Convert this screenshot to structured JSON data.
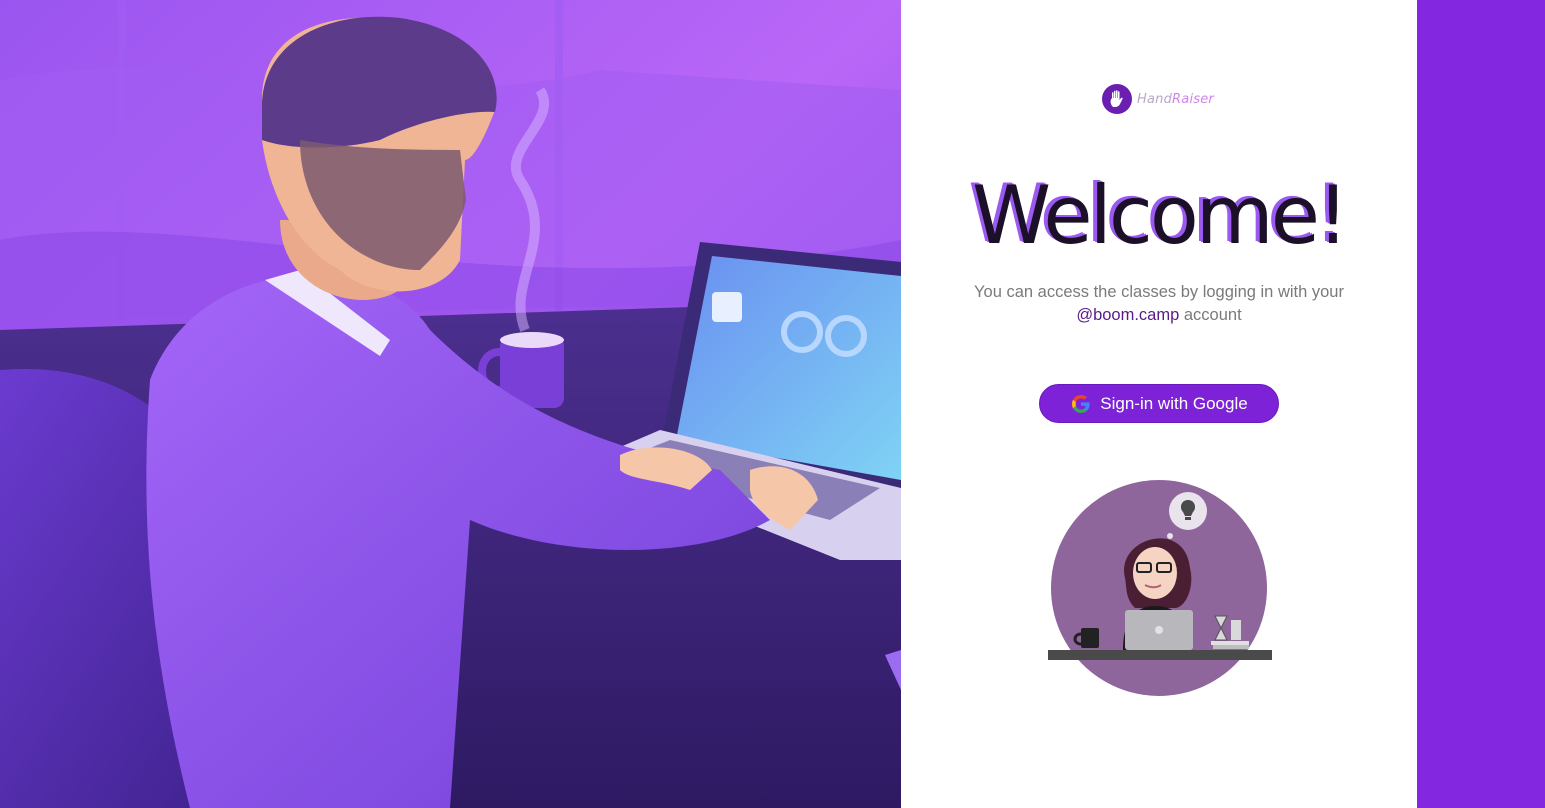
{
  "logo": {
    "icon": "raised-hand-icon",
    "word_hand": "Hand",
    "word_raiser": "Raiser"
  },
  "welcome_title": "Welcome!",
  "subtitle": {
    "line1": "You can access the classes by logging in with your",
    "domain": "@boom.camp",
    "after_domain": " account"
  },
  "signin_button": {
    "label": "Sign-in with Google",
    "icon": "google-g-icon"
  },
  "colors": {
    "brand_purple": "#8427e0",
    "button_purple": "#7d22d6",
    "title_shadow": "#9b59f2"
  }
}
